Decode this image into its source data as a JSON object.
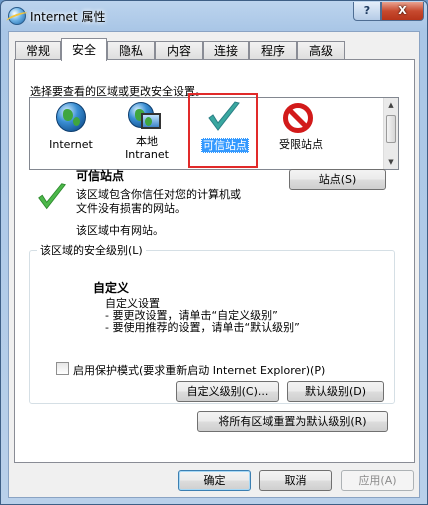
{
  "window": {
    "title": "Internet 属性",
    "help_label": "?",
    "close_label": "X"
  },
  "tabs": [
    {
      "label": "常规"
    },
    {
      "label": "安全"
    },
    {
      "label": "隐私"
    },
    {
      "label": "内容"
    },
    {
      "label": "连接"
    },
    {
      "label": "程序"
    },
    {
      "label": "高级"
    }
  ],
  "active_tab": "安全",
  "security": {
    "zones_prompt": "选择要查看的区域或更改安全设置。",
    "zones": [
      {
        "line1": "Internet",
        "line2": ""
      },
      {
        "line1": "本地",
        "line2": "Intranet"
      },
      {
        "line1": "可信站点",
        "line2": ""
      },
      {
        "line1": "受限站点",
        "line2": ""
      }
    ],
    "selected_zone": "可信站点",
    "zone_title": "可信站点",
    "zone_desc_line1": "该区域包含你信任对您的计算机或",
    "zone_desc_line2": "文件没有损害的网站。",
    "zone_sites_note": "该区域中有网站。",
    "sites_button": "站点(S)",
    "level_group_title": "该区域的安全级别(L)",
    "level_name": "自定义",
    "level_desc_1": "自定义设置",
    "level_desc_2": "- 要更改设置，请单击“自定义级别”",
    "level_desc_3": "- 要使用推荐的设置，请单击“默认级别”",
    "protected_mode_label": "启用保护模式(要求重新启动 Internet Explorer)(P)",
    "protected_mode_checked": false,
    "custom_level_button": "自定义级别(C)...",
    "default_level_button": "默认级别(D)",
    "reset_all_button": "将所有区域重置为默认级别(R)"
  },
  "footer": {
    "ok": "确定",
    "cancel": "取消",
    "apply": "应用(A)"
  },
  "colors": {
    "selection": "#3399ff",
    "highlight_box": "#e12a2a",
    "check_green": "#3aa84a",
    "restricted_red": "#d21a1a"
  }
}
